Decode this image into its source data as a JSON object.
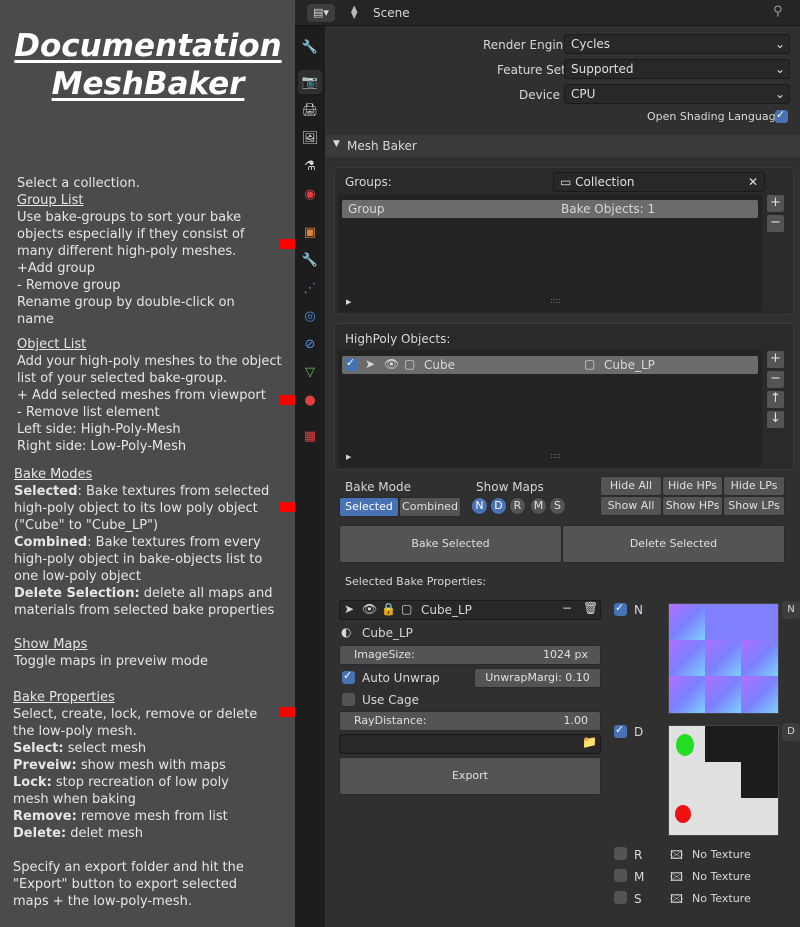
{
  "doc": {
    "title1": "Documentation",
    "title2": "MeshBaker",
    "l1": "Select a collection.",
    "l2": "Group List",
    "l3": "Use bake-groups to sort your bake",
    "l4": "objects especially if they consist of",
    "l5": "many different high-poly meshes.",
    "l6": "+Add group",
    "l7": "- Remove group",
    "l8": "Rename group by double-click on",
    "l9": "name",
    "l10": "Object List",
    "l11": "Add your high-poly meshes to the object",
    "l12": "list of your selected bake-group.",
    "l13": "+ Add selected meshes from viewport",
    "l14": "- Remove list element",
    "l15": "Left side: High-Poly-Mesh",
    "l16": "Right side: Low-Poly-Mesh",
    "l17": "Bake Modes",
    "l18a": "Selected",
    "l18b": ": Bake textures from selected",
    "l19": "high-poly object to its low poly object",
    "l20": "(\"Cube\" to \"Cube_LP\")",
    "l21a": "Combined",
    "l21b": ": Bake textures from every",
    "l22": "high-poly object in bake-objects list to",
    "l23": "one low-poly object",
    "l24a": "Delete Selection:",
    "l24b": " delete all maps and",
    "l25": "materials from selected bake properties",
    "l26": "Show Maps",
    "l27": "Toggle maps in preveiw mode",
    "l28": "Bake Properties",
    "l29": "Select, create, lock, remove or delete",
    "l30": "the low-poly mesh.",
    "l31a": "Select:",
    "l31b": " select mesh",
    "l32a": "Preveiw:",
    "l32b": " show mesh with maps",
    "l33a": "Lock:",
    "l33b": " stop recreation of low poly",
    "l34": "mesh when baking",
    "l35a": "Remove:",
    "l35b": " remove mesh from list",
    "l36a": "Delete:",
    "l36b": " delet mesh",
    "l37": "Specify an export folder and hit the",
    "l38": "\"Export\" button to export selected",
    "l39": "maps + the low-poly-mesh."
  },
  "header": {
    "scene": "Scene"
  },
  "render": {
    "engine_label": "Render Engine",
    "engine_value": "Cycles",
    "feature_label": "Feature Set",
    "feature_value": "Supported",
    "device_label": "Device",
    "device_value": "CPU",
    "osl_label": "Open Shading Language"
  },
  "meshbaker": {
    "panel_title": "Mesh Baker",
    "groups_label": "Groups:",
    "collection": "Collection",
    "group_name": "Group",
    "group_count": "Bake Objects: 1",
    "highpoly_label": "HighPoly Objects:",
    "hp_name": "Cube",
    "lp_name": "Cube_LP",
    "bake_mode_label": "Bake Mode",
    "mode_selected": "Selected",
    "mode_combined": "Combined",
    "show_maps_label": "Show Maps",
    "maps": [
      "N",
      "D",
      "R",
      "M",
      "S"
    ],
    "hide_all": "Hide All",
    "hide_hps": "Hide HPs",
    "hide_lps": "Hide LPs",
    "show_all": "Show All",
    "show_hps": "Show HPs",
    "show_lps": "Show LPs",
    "bake_selected": "Bake Selected",
    "delete_selected": "Delete Selected",
    "props_label": "Selected Bake Properties:",
    "prop_mesh": "Cube_LP",
    "prop_obj": "Cube_LP",
    "imagesize_label": "ImageSize:",
    "imagesize_value": "1024 px",
    "auto_unwrap": "Auto Unwrap",
    "unwrap_margin": "UnwrapMargi: 0.10",
    "use_cage": "Use Cage",
    "raydist_label": "RayDistance:",
    "raydist_value": "1.00",
    "export": "Export",
    "map_n": "N",
    "map_d": "D",
    "map_r": "R",
    "map_m": "M",
    "map_s": "S",
    "no_texture": "No Texture"
  }
}
